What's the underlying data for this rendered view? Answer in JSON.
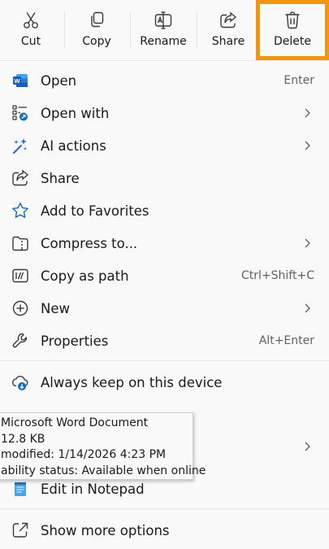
{
  "toolbar": {
    "cut": "Cut",
    "copy": "Copy",
    "rename": "Rename",
    "share": "Share",
    "delete": "Delete"
  },
  "items": {
    "open": {
      "label": "Open",
      "shortcut": "Enter"
    },
    "open_with": {
      "label": "Open with"
    },
    "ai_actions": {
      "label": "AI actions"
    },
    "share": {
      "label": "Share"
    },
    "favorites": {
      "label": "Add to Favorites"
    },
    "compress": {
      "label": "Compress to..."
    },
    "copy_path": {
      "label": "Copy as path",
      "shortcut": "Ctrl+Shift+C"
    },
    "new": {
      "label": "New"
    },
    "properties": {
      "label": "Properties",
      "shortcut": "Alt+Enter"
    },
    "keep_on_device": {
      "label": "Always keep on this device"
    },
    "edit_notepad": {
      "label": "Edit in Notepad"
    },
    "more_options": {
      "label": "Show more options"
    }
  },
  "tooltip": {
    "line1": "Microsoft Word Document",
    "line2": "12.8 KB",
    "line3": "modified: 1/14/2026 4:23 PM",
    "line4": "ability status: Available when online"
  },
  "colors": {
    "highlight_border": "#f2960e",
    "word_blue": "#185abd",
    "accent_blue": "#0f6cbd"
  },
  "icons": {
    "cut": "scissors-icon",
    "copy": "copy-icon",
    "rename": "rename-icon",
    "share": "share-icon",
    "delete": "trash-icon"
  }
}
